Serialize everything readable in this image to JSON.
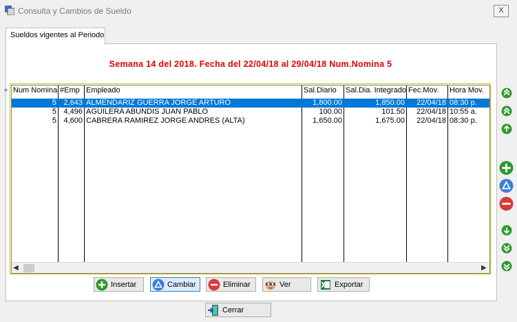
{
  "window": {
    "title": "Consulta y Cambios de Sueldo",
    "close_label": "X"
  },
  "tab": {
    "label": "Sueldos vigentes al Periodo"
  },
  "heading": "Semana  14 del  2018.  Fecha del  22/04/18 al  29/04/18   Num.Nomina  5",
  "grid": {
    "columns": [
      "Num Nomina",
      "#Emp",
      "Empleado",
      "Sal.Diario",
      "Sal.Dia. Integrado",
      "Fec.Mov.",
      "Hora Mov."
    ],
    "rows": [
      [
        "5",
        "2,643",
        "ALMENDARIZ GUERRA JORGE ARTURO",
        "1,800.00",
        "1,850.00",
        "22/04/18",
        "08:30 p."
      ],
      [
        "5",
        "4,496",
        "AGUILERA ABUNDIS JUAN PABLO",
        "100.00",
        "101.50",
        "22/04/18",
        "10:55 a."
      ],
      [
        "5",
        "4,600",
        "CABRERA RAMIREZ JORGE ANDRES (ALTA)",
        "1,650.00",
        "1,675.00",
        "22/04/18",
        "08:30 p."
      ]
    ],
    "selected_row": 0
  },
  "buttons": {
    "insertar": "Insertar",
    "cambiar": "Cambiar",
    "eliminar": "Eliminar",
    "ver": "Ver",
    "exportar": "Exportar",
    "cerrar": "Cerrar"
  },
  "colors": {
    "heading": "#e00000",
    "selection": "#0078d7",
    "nav_green": "#2e9a2e",
    "nav_blue": "#3a7fd8",
    "nav_red": "#d83a3a"
  }
}
